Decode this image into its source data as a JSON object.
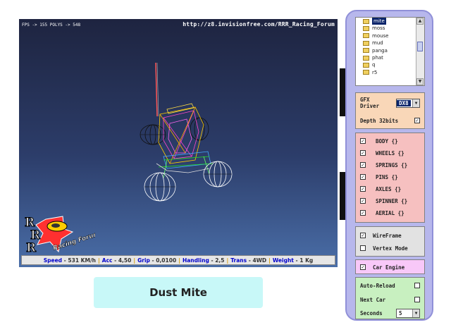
{
  "viewport": {
    "fps_text": "FPS -> 155 POLYS -> 548",
    "url_text": "http://z8.invisionfree.com/RRR_Racing_Forum",
    "logo": {
      "letters": [
        "R",
        "R",
        "R"
      ],
      "text": "Racing Forum"
    }
  },
  "status": [
    {
      "label": "Speed",
      "value": "- 531 KM/h"
    },
    {
      "label": "Acc",
      "value": "- 4,50"
    },
    {
      "label": "Grip",
      "value": "- 0,0100"
    },
    {
      "label": "Handling",
      "value": "- 2,5"
    },
    {
      "label": "Trans",
      "value": "- 4WD"
    },
    {
      "label": "Weight",
      "value": "- 1 Kg"
    }
  ],
  "car_name": "Dust Mite",
  "file_list": {
    "items": [
      "mite",
      "moss",
      "mouse",
      "mud",
      "panga",
      "phat",
      "q",
      "r5"
    ],
    "selected_index": 0
  },
  "gfx": {
    "driver_label": "GFX Driver",
    "driver_value": "DX8",
    "depth_label": "Depth 32bits",
    "depth_checked": true
  },
  "parts": [
    {
      "label": "BODY {}",
      "checked": true
    },
    {
      "label": "WHEELS {}",
      "checked": true
    },
    {
      "label": "SPRINGS {}",
      "checked": true
    },
    {
      "label": "PINS {}",
      "checked": true
    },
    {
      "label": "AXLES {}",
      "checked": true
    },
    {
      "label": "SPINNER {}",
      "checked": true
    },
    {
      "label": "AERIAL {}",
      "checked": true
    }
  ],
  "render": {
    "wireframe_label": "WireFrame",
    "wireframe_checked": true,
    "vertex_label": "Vertex Mode",
    "vertex_checked": false
  },
  "engine": {
    "label": "Car Engine",
    "checked": true
  },
  "misc": {
    "auto_reload_label": "Auto-Reload",
    "auto_reload_checked": false,
    "next_car_label": "Next Car",
    "next_car_checked": false,
    "seconds_label": "Seconds",
    "seconds_value": "5"
  }
}
